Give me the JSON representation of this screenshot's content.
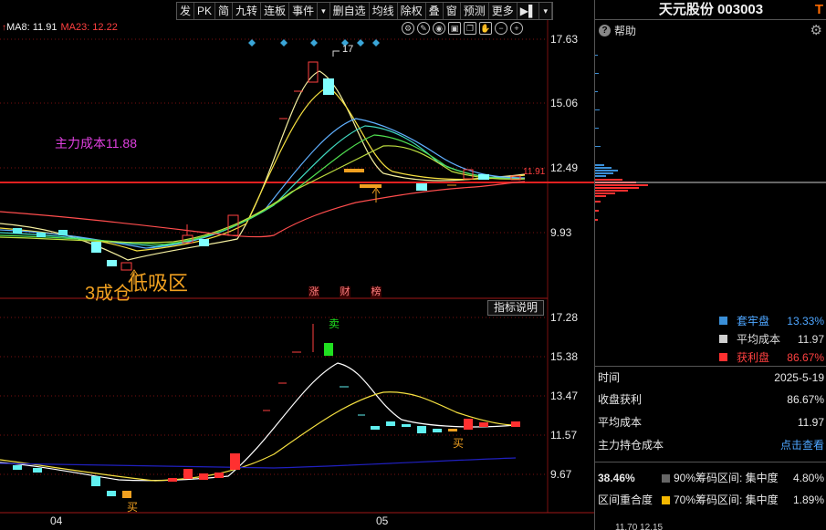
{
  "toolbar": {
    "items": [
      "发",
      "PK",
      "简",
      "九转",
      "连板",
      "事件",
      "▾",
      "删自选",
      "均线",
      "除权",
      "叠",
      "窗",
      "预测",
      "更多",
      "▶▌",
      "▾"
    ]
  },
  "legend": {
    "arrow": "↑",
    "ma8": "MA8: 11.91",
    "ma23": "MA23: 12.22"
  },
  "chart": {
    "price_ticks": [
      "17.63",
      "15.06",
      "12.49",
      "9.93"
    ],
    "main_cost_label": "主力成本11.88",
    "peak_label": "17",
    "current_price_tag": "11.91",
    "annotation_low_zone": "低吸区",
    "annotation_3_cheng": "3成仓",
    "event_labels": [
      "涨",
      "财",
      "榜"
    ],
    "indicator_button": "指标说明",
    "lower_ticks": [
      "17.28",
      "15.38",
      "13.47",
      "11.57",
      "9.67"
    ],
    "sell_label": "卖",
    "buy_label_1": "买",
    "buy_label_2": "买",
    "x_labels": [
      "04",
      "05"
    ]
  },
  "panel": {
    "stock_title": "天元股份 003003",
    "t_icon": "T",
    "help": "帮助",
    "chips_legend": [
      {
        "label": "套牢盘",
        "value": "13.33%",
        "color": "#3a8fd8"
      },
      {
        "label": "平均成本",
        "value": "11.97",
        "color": "#cfcfcf"
      },
      {
        "label": "获利盘",
        "value": "86.67%",
        "color": "#ff3030"
      }
    ],
    "info": [
      {
        "label": "时间",
        "value": "2025-5-19"
      },
      {
        "label": "收盘获利",
        "value": "86.67%"
      },
      {
        "label": "平均成本",
        "value": "11.97"
      },
      {
        "label": "主力持仓成本",
        "value": "点击查看"
      }
    ],
    "bottom": [
      {
        "left": "38.46%",
        "color": "#666666",
        "desc": "90%筹码区间: 集中度",
        "pct": "4.80%"
      },
      {
        "left": "区间重合度",
        "color": "#f5b800",
        "desc": "70%筹码区间: 集中度",
        "pct": "1.89%"
      }
    ],
    "cutoff_text": "11.70       12.15"
  }
}
